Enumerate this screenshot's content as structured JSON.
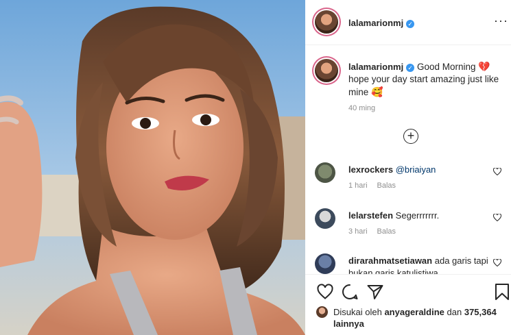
{
  "post": {
    "username": "lalamarionmj",
    "verified": true,
    "more_label": "···"
  },
  "caption": {
    "username": "lalamarionmj",
    "text_part1": "Good Morning",
    "text_part2": "hope your day start amazing just like mine",
    "emoji_1": "💔",
    "emoji_2": "🥰",
    "time": "40 ming"
  },
  "load_more_label": "+",
  "comments": [
    {
      "username": "lexrockers",
      "mention": "@briaiyan",
      "text": "",
      "time": "1 hari",
      "reply": "Balas"
    },
    {
      "username": "lelarstefen",
      "mention": "",
      "text": "Segerrrrrrr.",
      "time": "3 hari",
      "reply": "Balas"
    },
    {
      "username": "dirarahmatsetiawan",
      "mention": "",
      "text": "ada garis tapi bukan garis katulistiwa",
      "time": "",
      "reply": ""
    }
  ],
  "likes": {
    "prefix": "Disukai oleh",
    "user": "anyageraldine",
    "conj": "dan",
    "count": "375,364 lainnya"
  },
  "icons": {
    "like": "heart-icon",
    "comment": "comment-icon",
    "share": "share-icon",
    "save": "bookmark-icon",
    "more": "more-icon",
    "add": "plus-circle-icon"
  },
  "colors": {
    "verified": "#3897f0",
    "secondary_text": "#8e8e8e",
    "mention": "#00376b"
  }
}
